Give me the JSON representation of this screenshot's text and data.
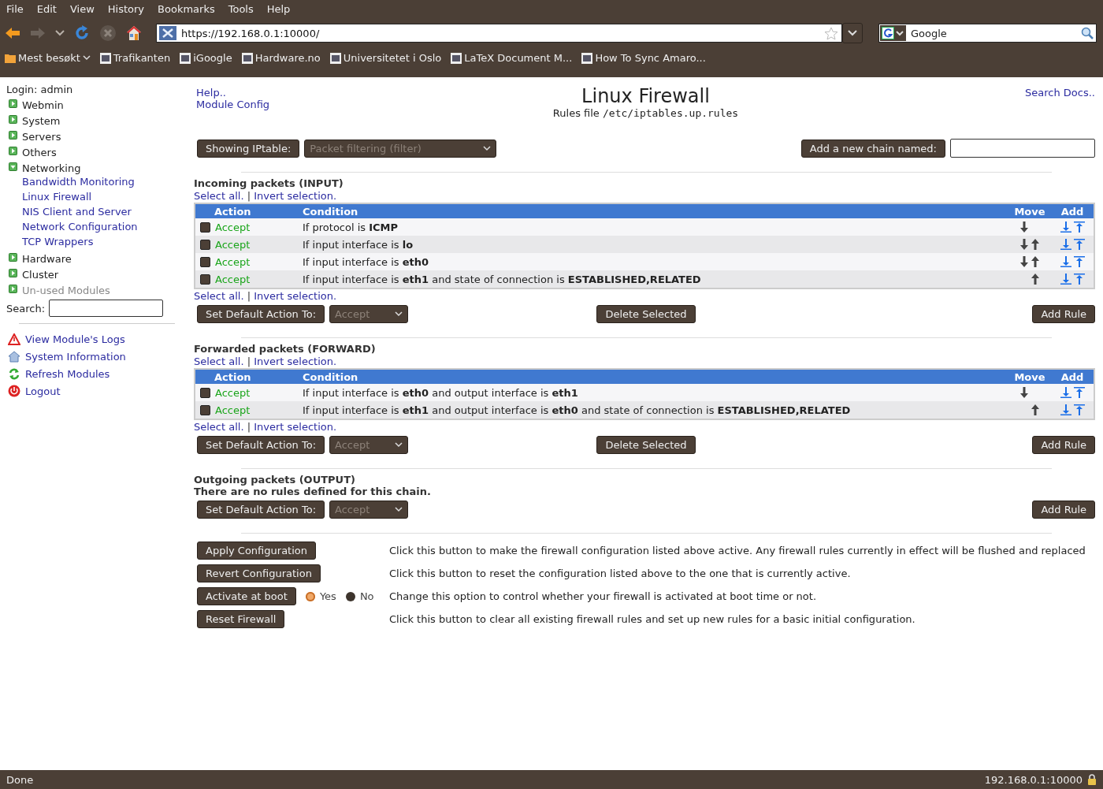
{
  "menu": [
    "File",
    "Edit",
    "View",
    "History",
    "Bookmarks",
    "Tools",
    "Help"
  ],
  "address": {
    "value": "https://192.168.0.1:10000/"
  },
  "web_search": {
    "placeholder": "Google"
  },
  "bookmarks": [
    {
      "label": "Mest besøkt",
      "kind": "folder"
    },
    {
      "label": "Trafikanten",
      "kind": "link"
    },
    {
      "label": "iGoogle",
      "kind": "link"
    },
    {
      "label": "Hardware.no",
      "kind": "link"
    },
    {
      "label": "Universitetet i Oslo",
      "kind": "link"
    },
    {
      "label": "LaTeX Document M...",
      "kind": "link"
    },
    {
      "label": "How To Sync Amaro...",
      "kind": "link"
    }
  ],
  "sidebar": {
    "login": "Login: admin",
    "categories": [
      {
        "label": "Webmin",
        "expanded": false,
        "disabled": false
      },
      {
        "label": "System",
        "expanded": false,
        "disabled": false
      },
      {
        "label": "Servers",
        "expanded": false,
        "disabled": false
      },
      {
        "label": "Others",
        "expanded": false,
        "disabled": false
      },
      {
        "label": "Networking",
        "expanded": true,
        "disabled": false,
        "children": [
          "Bandwidth Monitoring",
          "Linux Firewall",
          "NIS Client and Server",
          "Network Configuration",
          "TCP Wrappers"
        ]
      },
      {
        "label": "Hardware",
        "expanded": false,
        "disabled": false
      },
      {
        "label": "Cluster",
        "expanded": false,
        "disabled": false
      },
      {
        "label": "Un-used Modules",
        "expanded": false,
        "disabled": true
      }
    ],
    "search_label": "Search:",
    "links": [
      {
        "label": "View Module's Logs",
        "kind": "warning"
      },
      {
        "label": "System Information",
        "kind": "home"
      },
      {
        "label": "Refresh Modules",
        "kind": "refresh"
      },
      {
        "label": "Logout",
        "kind": "power"
      }
    ]
  },
  "header": {
    "links": [
      "Help..",
      "Module Config"
    ],
    "title": "Linux Firewall",
    "subtitle_label": "Rules file",
    "subtitle_path": "/etc/iptables.up.rules",
    "search_docs": "Search Docs.."
  },
  "table_selector": {
    "button": "Showing IPtable:",
    "value": "Packet filtering (filter)",
    "new_chain_button": "Add a new chain named:"
  },
  "chains": [
    {
      "title": "Incoming packets (INPUT)",
      "selection_links": [
        {
          "select_all": "Select all.",
          "separator": "|",
          "invert": "Invert selection."
        },
        {
          "select_all": "Select all.",
          "separator": "|",
          "invert": "Invert selection."
        }
      ],
      "columns": [
        "Action",
        "Condition",
        "Move",
        "Add"
      ],
      "rules": [
        {
          "checked": false,
          "action": "Accept",
          "condition": "If protocol is **ICMP**",
          "move_down": true,
          "move_up": false
        },
        {
          "checked": false,
          "action": "Accept",
          "condition": "If input interface is **lo**",
          "move_down": true,
          "move_up": true
        },
        {
          "checked": false,
          "action": "Accept",
          "condition": "If input interface is **eth0**",
          "move_down": true,
          "move_up": true
        },
        {
          "checked": false,
          "action": "Accept",
          "condition": "If input interface is **eth1** and state of connection is **ESTABLISHED,RELATED**",
          "move_down": false,
          "move_up": true
        }
      ],
      "default_button": "Set Default Action To:",
      "default_value": "Accept",
      "delete_button": "Delete Selected",
      "add_button": "Add Rule"
    },
    {
      "title": "Forwarded packets (FORWARD)",
      "selection_links": [
        {
          "select_all": "Select all.",
          "separator": "|",
          "invert": "Invert selection."
        },
        {
          "select_all": "Select all.",
          "separator": "|",
          "invert": "Invert selection."
        }
      ],
      "columns": [
        "Action",
        "Condition",
        "Move",
        "Add"
      ],
      "rules": [
        {
          "checked": false,
          "action": "Accept",
          "condition": "If input interface is **eth0** and output interface is **eth1**",
          "move_down": true,
          "move_up": false
        },
        {
          "checked": false,
          "action": "Accept",
          "condition": "If input interface is **eth1** and output interface is **eth0** and state of connection is **ESTABLISHED,RELATED**",
          "move_down": false,
          "move_up": true
        }
      ],
      "default_button": "Set Default Action To:",
      "default_value": "Accept",
      "delete_button": "Delete Selected",
      "add_button": "Add Rule"
    },
    {
      "title": "Outgoing packets (OUTPUT)",
      "empty_message": "There are no rules defined for this chain.",
      "default_button": "Set Default Action To:",
      "default_value": "Accept",
      "add_button": "Add Rule"
    }
  ],
  "actions": [
    {
      "button": "Apply Configuration",
      "description": "Click this button to make the firewall configuration listed above active. Any firewall rules currently in effect will be flushed and replaced"
    },
    {
      "button": "Revert Configuration",
      "description": "Click this button to reset the configuration listed above to the one that is currently active."
    },
    {
      "button": "Activate at boot",
      "options": [
        {
          "label": "Yes",
          "selected": true
        },
        {
          "label": "No",
          "selected": false
        }
      ],
      "description": "Change this option to control whether your firewall is activated at boot time or not."
    },
    {
      "button": "Reset Firewall",
      "description": "Click this button to clear all existing firewall rules and set up new rules for a basic initial configuration."
    }
  ],
  "status_bar": {
    "text": "Done",
    "host": "192.168.0.1:10000"
  }
}
